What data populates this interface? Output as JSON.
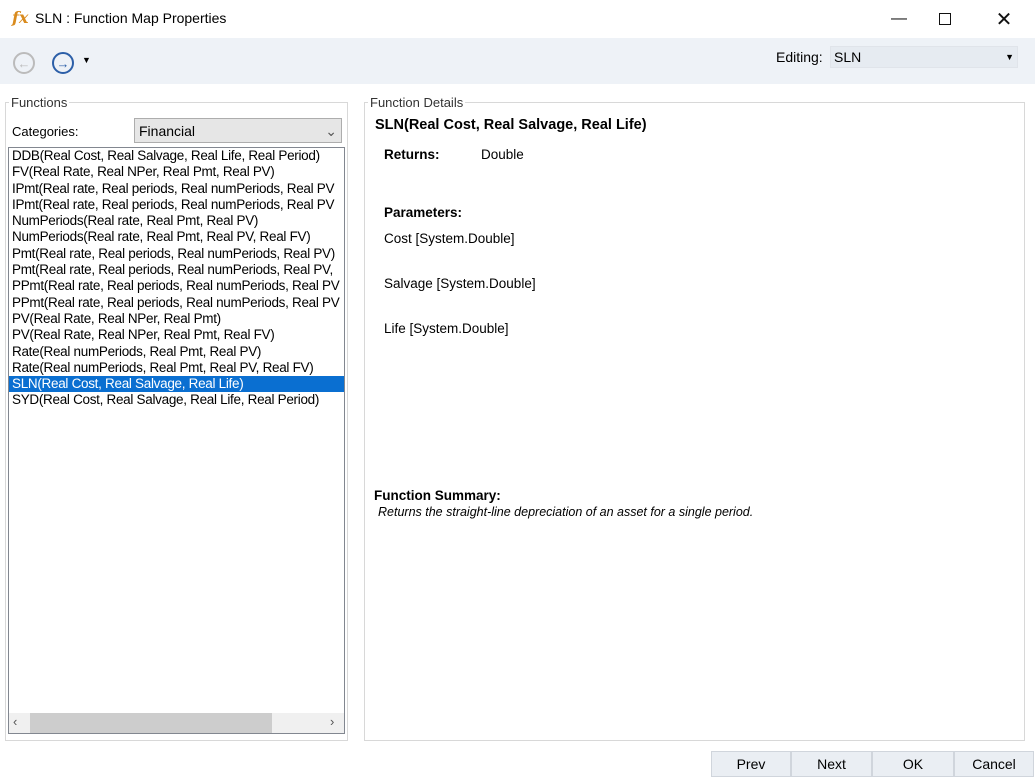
{
  "window": {
    "title": "SLN : Function Map Properties",
    "icon": "fx-icon"
  },
  "toolbar": {
    "editing_label": "Editing:",
    "editing_value": "SLN"
  },
  "functions": {
    "group_title": "Functions",
    "categories_label": "Categories:",
    "category_value": "Financial",
    "items": [
      "DDB(Real Cost, Real Salvage, Real Life, Real Period)",
      "FV(Real Rate, Real NPer, Real Pmt, Real PV)",
      "IPmt(Real rate, Real periods, Real numPeriods, Real PV",
      "IPmt(Real rate, Real periods, Real numPeriods, Real PV",
      "NumPeriods(Real rate, Real Pmt, Real PV)",
      "NumPeriods(Real rate, Real Pmt, Real PV, Real FV)",
      "Pmt(Real rate, Real periods, Real numPeriods, Real PV)",
      "Pmt(Real rate, Real periods, Real numPeriods, Real PV,",
      "PPmt(Real rate, Real periods, Real numPeriods, Real PV",
      "PPmt(Real rate, Real periods, Real numPeriods, Real PV",
      "PV(Real Rate, Real NPer, Real Pmt)",
      "PV(Real Rate, Real NPer, Real Pmt, Real FV)",
      "Rate(Real numPeriods, Real Pmt, Real PV)",
      "Rate(Real numPeriods, Real Pmt, Real PV, Real FV)",
      "SLN(Real Cost, Real Salvage, Real Life)",
      "SYD(Real Cost, Real Salvage, Real Life, Real Period)"
    ],
    "selected_index": 14
  },
  "details": {
    "group_title": "Function Details",
    "signature": "SLN(Real Cost, Real Salvage, Real Life)",
    "returns_label": "Returns:",
    "returns_value": "Double",
    "parameters_label": "Parameters:",
    "parameters": [
      "Cost [System.Double]",
      "Salvage [System.Double]",
      "Life [System.Double]"
    ],
    "summary_label": "Function Summary:",
    "summary_text": "Returns the straight-line depreciation of an asset for a single period."
  },
  "buttons": {
    "prev": "Prev",
    "next": "Next",
    "ok": "OK",
    "cancel": "Cancel"
  },
  "colors": {
    "selection": "#0a6fd1",
    "toolbar": "#eef2f7"
  }
}
